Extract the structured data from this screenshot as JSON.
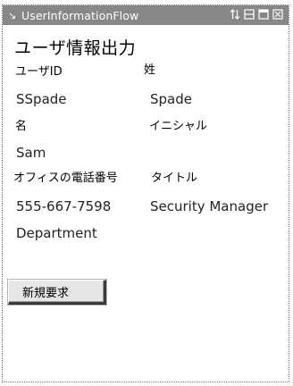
{
  "window": {
    "title": "UserInformationFlow",
    "controls": [
      "sort-icon",
      "restore-icon",
      "maximize-icon",
      "close-icon"
    ]
  },
  "heading": "ユーザ情報出力",
  "labels": {
    "user_id": "ユーザID",
    "last_name": "姓",
    "first_name": "名",
    "initial": "イニシャル",
    "office_phone": "オフィスの電話番号",
    "job_title": "タイトル"
  },
  "values": {
    "user_id": "SSpade",
    "last_name": "Spade",
    "first_name": "Sam",
    "office_phone": "555-667-7598",
    "job_title": "Security Manager",
    "department": "Department"
  },
  "actions": {
    "new_request": "新規要求"
  }
}
